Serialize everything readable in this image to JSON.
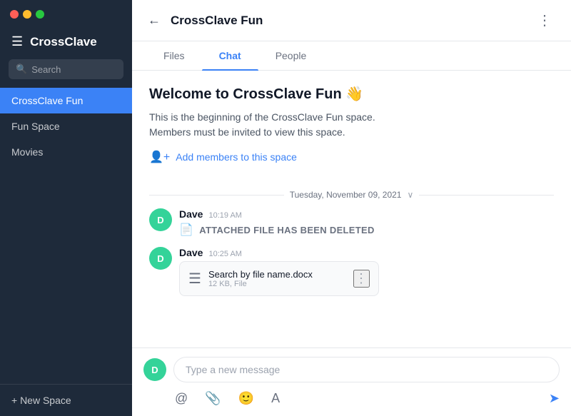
{
  "window": {
    "title": "CrossClave"
  },
  "sidebar": {
    "title": "CrossClave",
    "search_placeholder": "Search",
    "items": [
      {
        "id": "crossclave-fun",
        "label": "CrossClave Fun",
        "active": true
      },
      {
        "id": "fun-space",
        "label": "Fun Space",
        "active": false
      },
      {
        "id": "movies",
        "label": "Movies",
        "active": false
      }
    ],
    "new_space_label": "+ New Space"
  },
  "header": {
    "title": "CrossClave Fun",
    "back_label": "←",
    "more_label": "⋮"
  },
  "tabs": [
    {
      "id": "files",
      "label": "Files",
      "active": false
    },
    {
      "id": "chat",
      "label": "Chat",
      "active": true
    },
    {
      "id": "people",
      "label": "People",
      "active": false
    }
  ],
  "welcome": {
    "title": "Welcome to CrossClave Fun 👋",
    "description_line1": "This is the beginning of the CrossClave Fun space.",
    "description_line2": "Members must be invited to view this space.",
    "add_members_label": "Add members to this space"
  },
  "date_divider": {
    "text": "Tuesday, November 09, 2021"
  },
  "messages": [
    {
      "id": "msg1",
      "author": "Dave",
      "avatar_letter": "D",
      "time": "10:19 AM",
      "deleted": true,
      "deleted_text": "ATTACHED FILE HAS BEEN DELETED"
    },
    {
      "id": "msg2",
      "author": "Dave",
      "avatar_letter": "D",
      "time": "10:25 AM",
      "deleted": false,
      "file": {
        "name": "Search by file name.docx",
        "meta": "12 KB, File"
      }
    }
  ],
  "input": {
    "placeholder": "Type a new message",
    "avatar_letter": "D"
  },
  "toolbar": {
    "at_icon": "@",
    "clip_icon": "📎",
    "emoji_icon": "🙂",
    "text_icon": "A",
    "send_icon": "➤"
  },
  "colors": {
    "sidebar_bg": "#1e2a3a",
    "active_tab": "#3b82f6",
    "avatar_bg": "#34d399"
  }
}
